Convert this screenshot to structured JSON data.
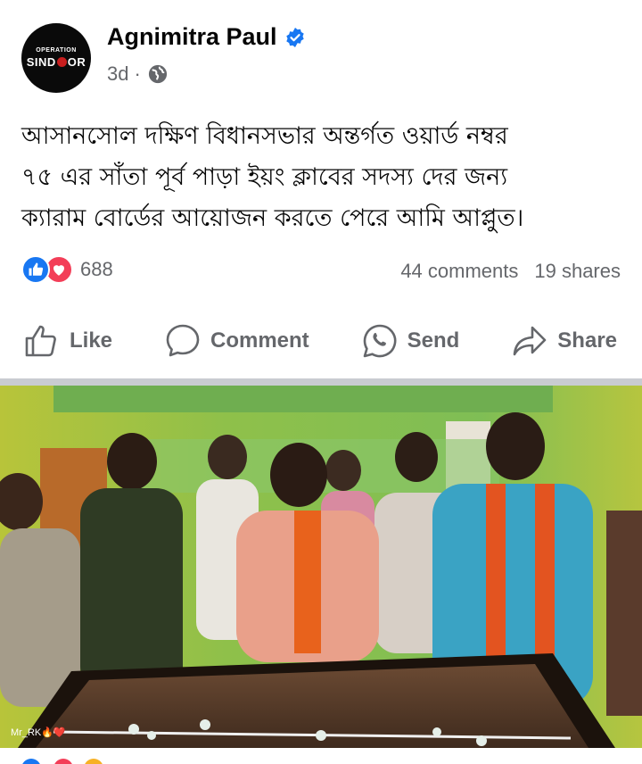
{
  "post": {
    "author": "Agnimitra Paul",
    "time": "3d",
    "separator": "·",
    "avatar": {
      "line1": "OPERATION",
      "line2a": "SIND",
      "line2b": "OR"
    },
    "text_lines": [
      "আসানসোল দক্ষিণ বিধানসভার  অন্তর্গত ওয়ার্ড নম্বর",
      "৭৫ এর সাঁতা পূর্ব পাড়া ইয়ং ক্লাবের সদস্য দের জন্য",
      "ক্যারাম বোর্ডের  আয়োজন করতে পেরে আমি আপ্লুত।"
    ]
  },
  "stats": {
    "reaction_count": "688",
    "comments": "44 comments",
    "shares": "19 shares"
  },
  "actions": {
    "like": "Like",
    "comment": "Comment",
    "send": "Send",
    "share": "Share"
  },
  "photo": {
    "watermark": "Mr_RK🔥❤️"
  },
  "icons": {
    "verified": "verified-badge-icon",
    "audience": "globe-icon",
    "like_reaction": "thumbs-up-icon",
    "love_reaction": "heart-icon"
  },
  "colors": {
    "brand_blue": "#1877f2",
    "love_red": "#f33e58",
    "secondary_text": "#65676b",
    "divider": "#c9ccd1"
  }
}
